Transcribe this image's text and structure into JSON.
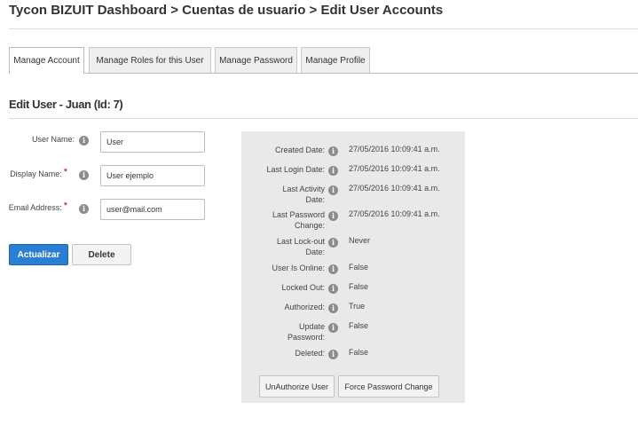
{
  "breadcrumb": "Tycon BIZUIT Dashboard > Cuentas de usuario > Edit User Accounts",
  "tabs": [
    {
      "label": "Manage Account",
      "active": true
    },
    {
      "label": "Manage Roles for this User",
      "active": false
    },
    {
      "label": "Manage Password",
      "active": false
    },
    {
      "label": "Manage Profile",
      "active": false
    }
  ],
  "section_title": "Edit User - Juan (Id: 7)",
  "form": {
    "username_label": "User Name:",
    "username_value": "User",
    "display_name_label": "Display Name:",
    "display_name_value": "User ejemplo",
    "email_label": "Email Address:",
    "email_value": "user@mail.com",
    "required_marker": "*"
  },
  "buttons": {
    "update": "Actualizar",
    "delete": "Delete"
  },
  "info_glyph": "i",
  "details": {
    "created_date_label": "Created Date:",
    "created_date_value": "27/05/2016 10:09:41 a.m.",
    "last_login_label": "Last Login Date:",
    "last_login_value": "27/05/2016 10:09:41 a.m.",
    "last_activity_label": "Last Activity Date:",
    "last_activity_value": "27/05/2016 10:09:41 a.m.",
    "last_password_label": "Last Password Change:",
    "last_password_value": "27/05/2016 10:09:41 a.m.",
    "last_lockout_label": "Last Lock-out Date:",
    "last_lockout_value": "Never",
    "online_label": "User Is Online:",
    "online_value": "False",
    "locked_label": "Locked Out:",
    "locked_value": "False",
    "authorized_label": "Authorized:",
    "authorized_value": "True",
    "update_password_label": "Update Password:",
    "update_password_value": "False",
    "deleted_label": "Deleted:",
    "deleted_value": "False"
  },
  "panel_buttons": {
    "unauthorize": "UnAuthorize User",
    "force_password": "Force Password Change"
  },
  "colors": {
    "primary": "#2b7fd3",
    "panel_bg": "#e9e9e9",
    "required": "#cc0000"
  }
}
